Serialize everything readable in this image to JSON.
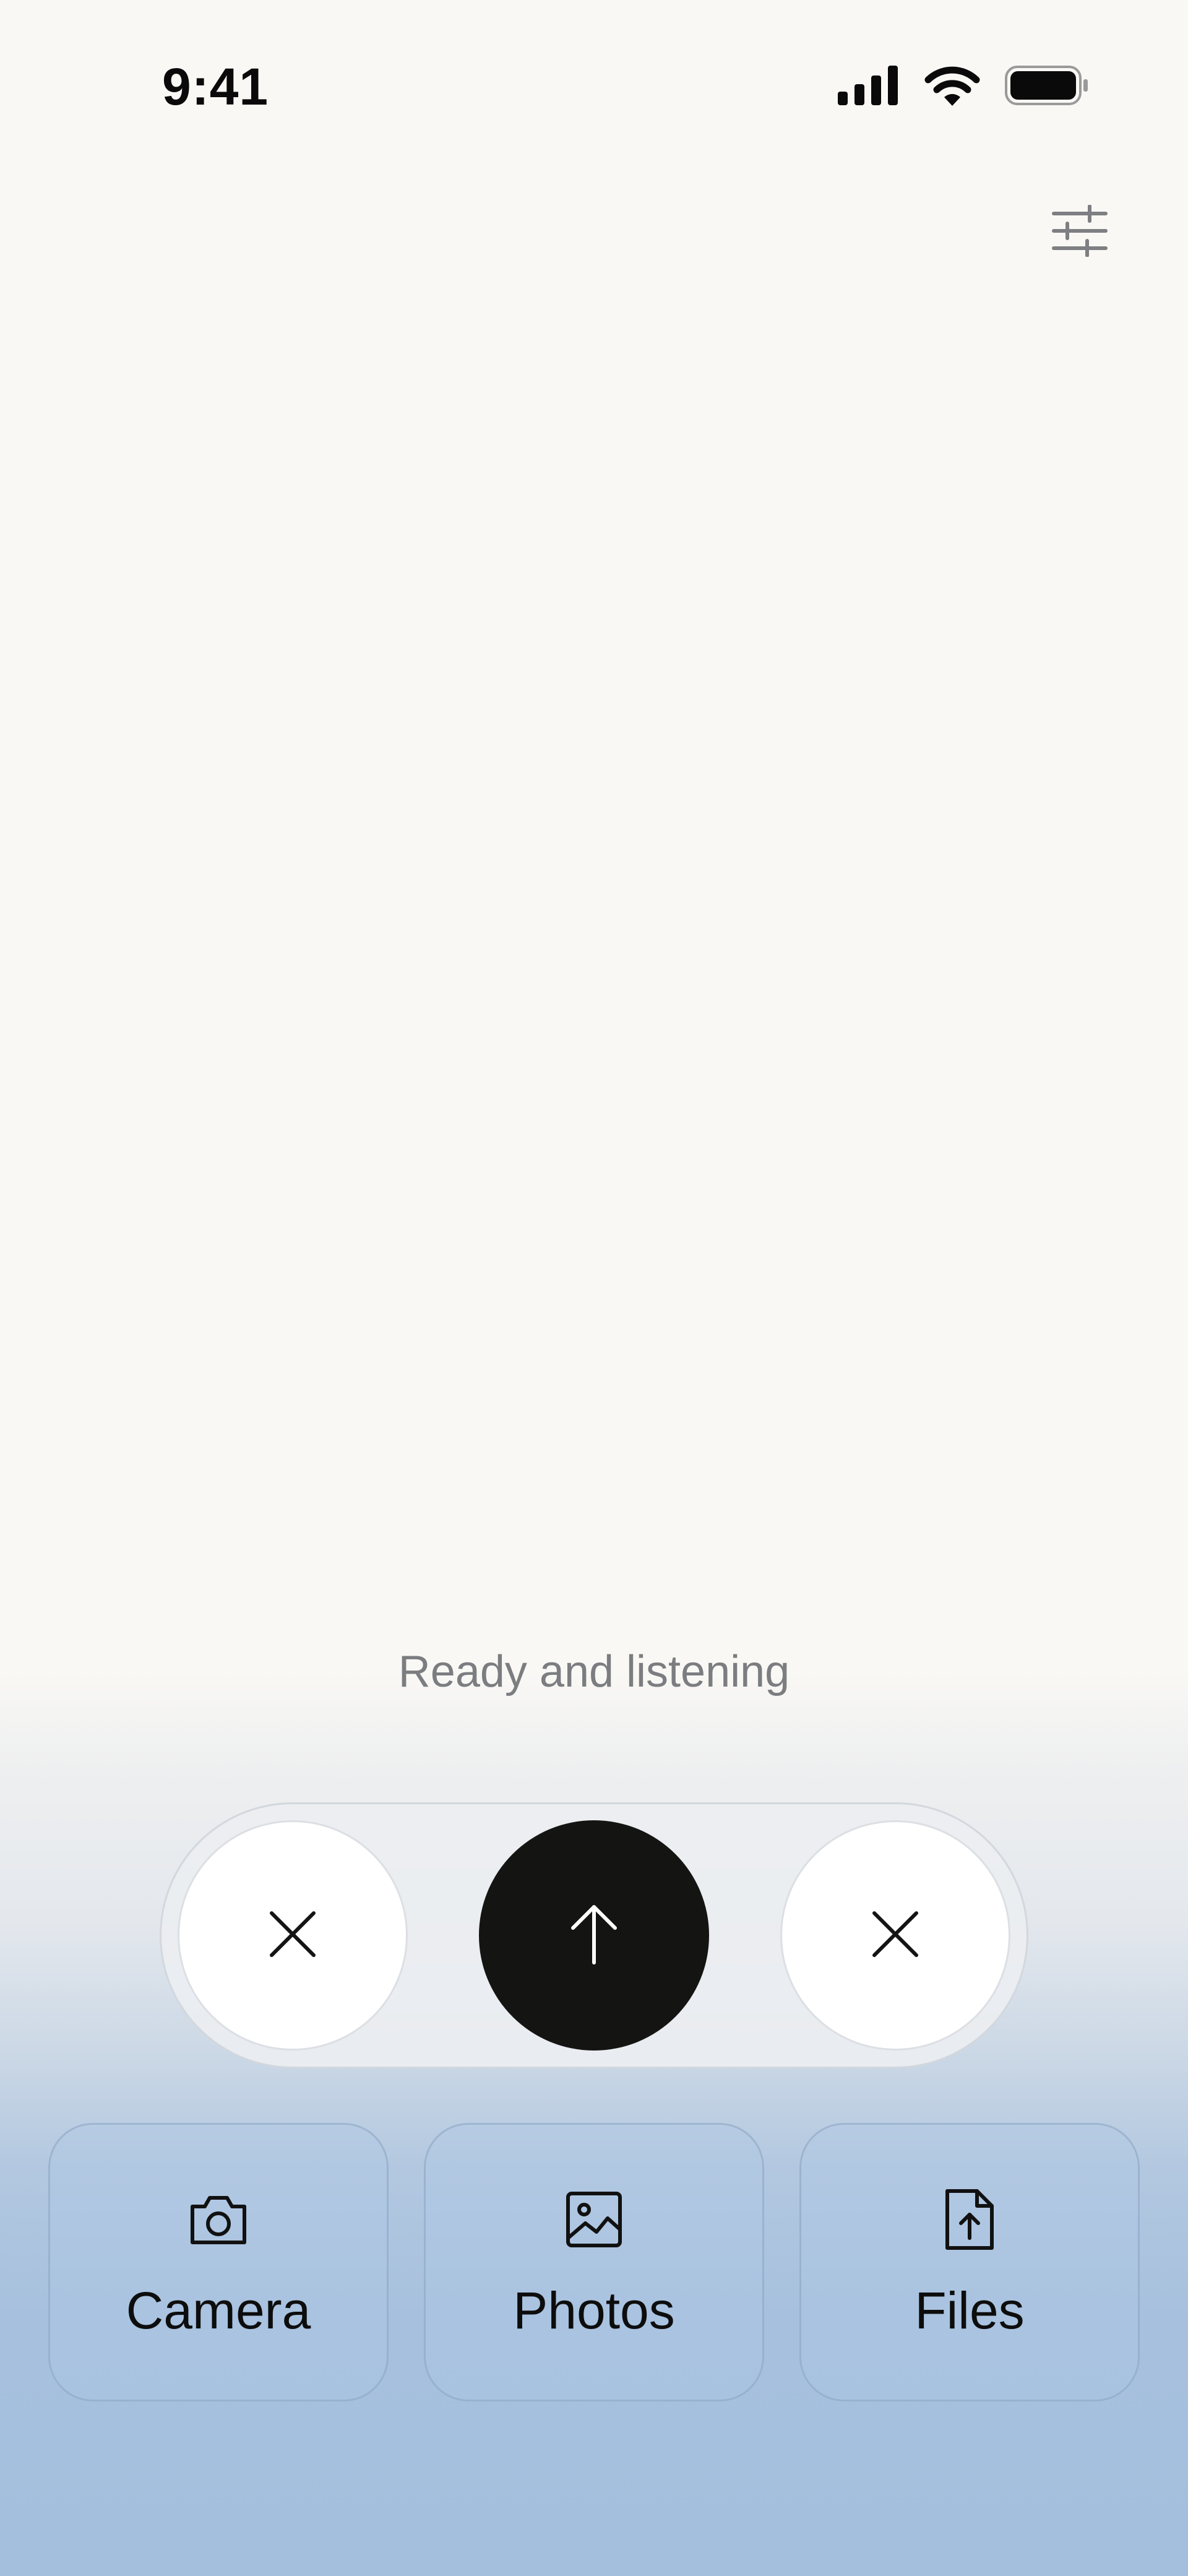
{
  "status_bar": {
    "time": "9:41",
    "icons": [
      "cellular-signal-icon",
      "wifi-icon",
      "battery-icon"
    ]
  },
  "header": {
    "settings_icon": "sliders-icon"
  },
  "main": {
    "status_text": "Ready and listening"
  },
  "controls": {
    "left_button_icon": "close-icon",
    "center_button_icon": "arrow-up-icon",
    "right_button_icon": "close-icon"
  },
  "attachments": [
    {
      "label": "Camera",
      "icon": "camera-icon"
    },
    {
      "label": "Photos",
      "icon": "image-icon"
    },
    {
      "label": "Files",
      "icon": "file-upload-icon"
    }
  ],
  "colors": {
    "background": "#f9f8f5",
    "gradient_bottom": "#a4bfdd",
    "primary_button": "#141412",
    "status_text": "#7b7d80"
  }
}
